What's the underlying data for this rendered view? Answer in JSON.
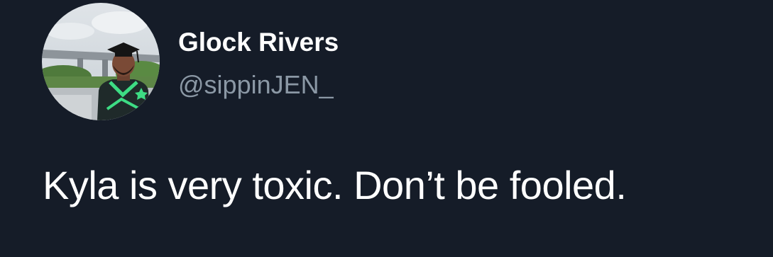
{
  "tweet": {
    "author": {
      "display_name": "Glock Rivers",
      "handle": "@sippinJEN_",
      "avatar_icon": "profile-photo"
    },
    "text": "Kyla is very toxic. Don’t be fooled."
  },
  "colors": {
    "background": "#151c28",
    "name": "#ffffff",
    "handle": "#8b98a5",
    "text": "#ffffff"
  }
}
